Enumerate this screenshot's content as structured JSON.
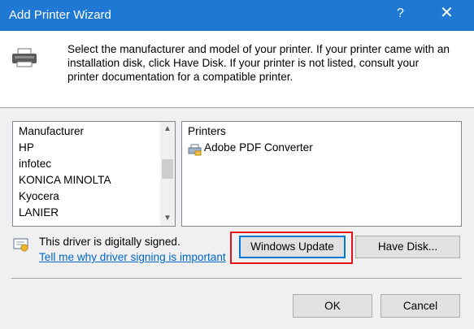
{
  "window": {
    "title": "Add Printer Wizard",
    "help_glyph": "?",
    "close_glyph": "✕"
  },
  "header": {
    "description": "Select the manufacturer and model of your printer. If your printer came with an installation disk, click Have Disk. If your printer is not listed, consult your printer documentation for a compatible printer."
  },
  "manufacturer_list": {
    "header": "Manufacturer",
    "items": [
      "HP",
      "infotec",
      "KONICA MINOLTA",
      "Kyocera",
      "LANIER"
    ]
  },
  "printers_list": {
    "header": "Printers",
    "items": [
      "Adobe PDF Converter"
    ]
  },
  "signing": {
    "status": "This driver is digitally signed.",
    "link": "Tell me why driver signing is important"
  },
  "buttons": {
    "windows_update": "Windows Update",
    "have_disk": "Have Disk...",
    "ok": "OK",
    "cancel": "Cancel"
  },
  "colors": {
    "titlebar": "#1e78d4",
    "highlight": "#e3141c",
    "link": "#0066cc"
  }
}
